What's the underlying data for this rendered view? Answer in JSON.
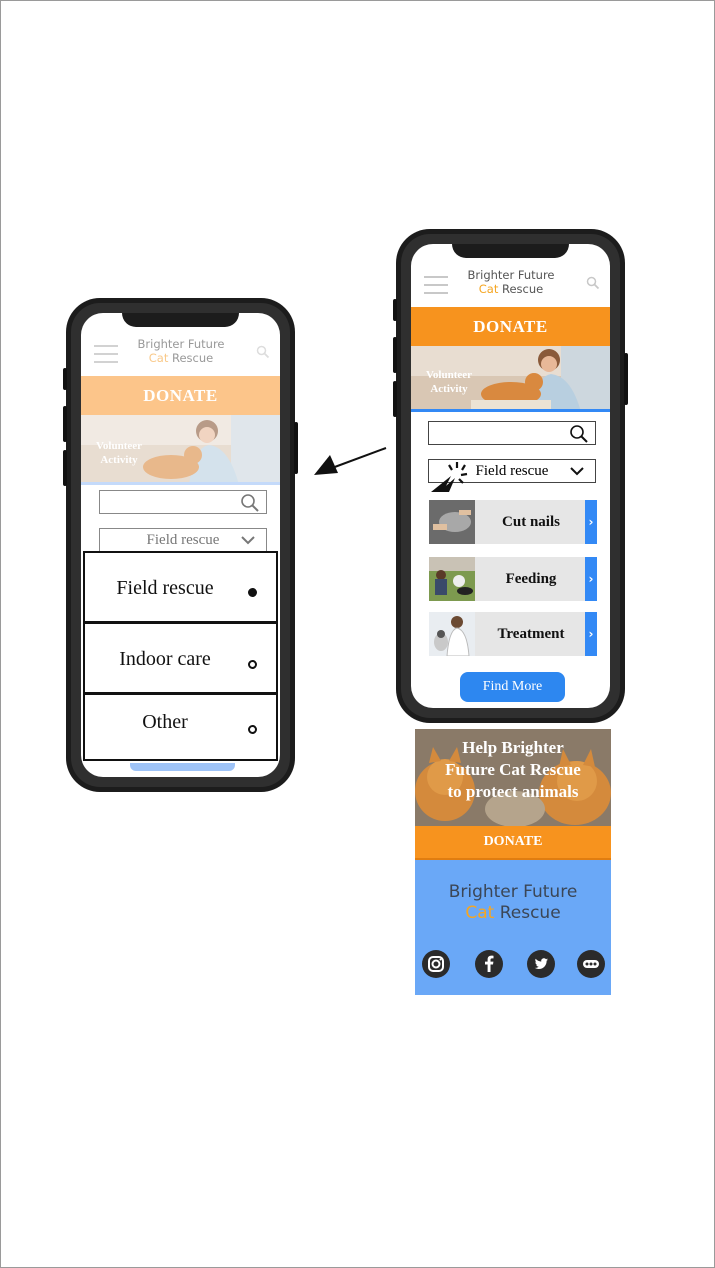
{
  "brand": {
    "line1": "Brighter Future",
    "cat": "Cat",
    "rescue": "Rescue"
  },
  "right_phone": {
    "donate_label": "DONATE",
    "hero_caption": {
      "line1": "Volunteer",
      "line2": "Activity"
    },
    "search": {
      "placeholder": ""
    },
    "dropdown_value": "Field rescue",
    "items": [
      {
        "label": "Cut nails"
      },
      {
        "label": "Feeding"
      },
      {
        "label": "Treatment"
      }
    ],
    "find_more_label": "Find More"
  },
  "left_phone": {
    "donate_label": "DONATE",
    "hero_caption": {
      "line1": "Volunteer",
      "line2": "Activity"
    },
    "dropdown_value": "Field rescue",
    "options": [
      {
        "label": "Field rescue",
        "selected": true
      },
      {
        "label": "Indoor care",
        "selected": false
      },
      {
        "label": "Other",
        "selected": false
      }
    ]
  },
  "footer": {
    "banner_text": "Help Brighter Future Cat Rescue to protect animals",
    "donate_label": "DONATE",
    "social_icons": [
      "instagram-icon",
      "facebook-icon",
      "twitter-icon",
      "more-icon"
    ]
  },
  "colors": {
    "orange": "#f7931e",
    "orange_faded": "#fcc58a",
    "blue": "#2d87f0",
    "footer_blue": "#6aa8f7",
    "brand_cat": "#f5a623"
  }
}
